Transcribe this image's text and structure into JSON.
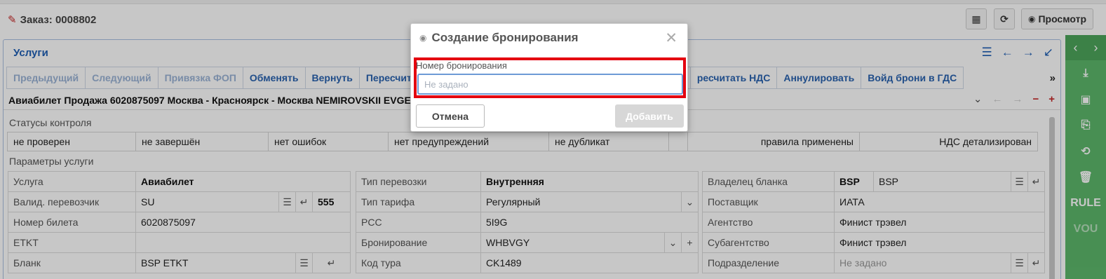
{
  "header": {
    "title": "Заказ: 0008802",
    "preview_label": "Просмотр"
  },
  "panel": {
    "title": "Услуги",
    "toolbar": [
      "Предыдущий",
      "Следующий",
      "Привязка ФОП",
      "Обменять",
      "Вернуть",
      "Пересчитать",
      "ресчитать НДС",
      "Аннулировать",
      "Войд брони в ГДС"
    ],
    "toolbar_disabled": [
      0,
      1,
      2
    ],
    "toolbar_more": "»",
    "service_line": "Авиабилет Продажа 6020875097 Москва - Красноярск - Москва NEMIROVSKII EVGE"
  },
  "status_section": {
    "label": "Статусы контроля",
    "items": [
      "не проверен",
      "не завершён",
      "нет ошибок",
      "нет предупреждений",
      "не дубликат",
      "",
      "правила применены",
      "НДС детализирован"
    ]
  },
  "params_section": {
    "label": "Параметры услуги",
    "col1": [
      {
        "label": "Услуга",
        "value": "Авиабилет"
      },
      {
        "label": "Валид. перевозчик",
        "value": "SU",
        "extra": "555"
      },
      {
        "label": "Номер билета",
        "value": "6020875097"
      },
      {
        "label": "ETKT",
        "value": ""
      },
      {
        "label": "Бланк",
        "value": "BSP ETKT"
      }
    ],
    "col2": [
      {
        "label": "Тип перевозки",
        "value": "Внутренняя"
      },
      {
        "label": "Тип тарифа",
        "value": "Регулярный"
      },
      {
        "label": "PCC",
        "value": "5I9G"
      },
      {
        "label": "Бронирование",
        "value": "WHBVGY"
      },
      {
        "label": "Код тура",
        "value": "CK1489"
      }
    ],
    "col3": [
      {
        "label": "Владелец бланка",
        "code": "BSP",
        "value": "BSP"
      },
      {
        "label": "Поставщик",
        "value": "ИАТА"
      },
      {
        "label": "Агентство",
        "value": "Финист трэвел"
      },
      {
        "label": "Субагентство",
        "value": "Финист трэвел"
      },
      {
        "label": "Подразделение",
        "placeholder": "Не задано"
      }
    ]
  },
  "rightbar": {
    "rule_label": "RULE",
    "vou_label": "VOU"
  },
  "dialog": {
    "title": "Создание бронирования",
    "field_label": "Номер бронирования",
    "field_placeholder": "Не задано",
    "field_value": "",
    "cancel_label": "Отмена",
    "add_label": "Добавить"
  },
  "colors": {
    "accent": "#2a63b0",
    "highlight": "#e4000f",
    "rightbar": "#5db86b"
  }
}
